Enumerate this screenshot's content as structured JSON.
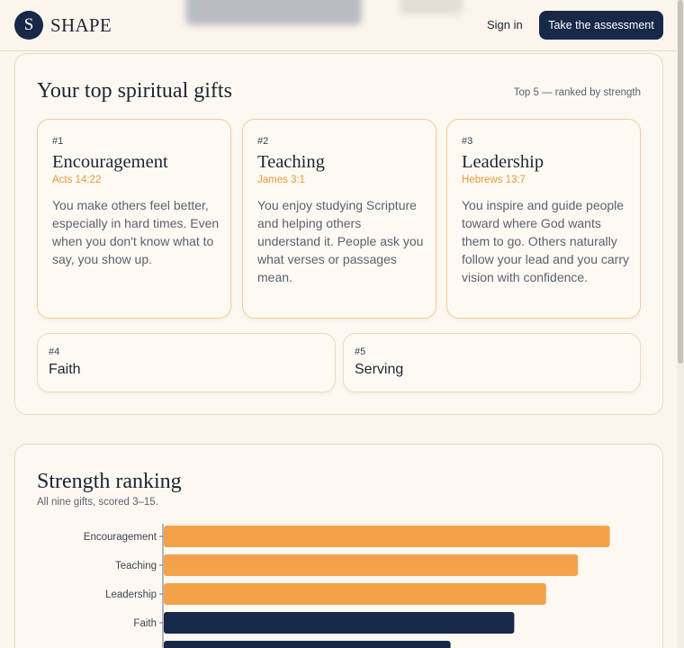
{
  "header": {
    "brand_initial": "S",
    "brand_name": "SHAPE",
    "sign_in_label": "Sign in",
    "cta_label": "Take the assessment"
  },
  "top_gifts": {
    "title": "Your top spiritual gifts",
    "subtitle": "Top 5 — ranked by strength",
    "featured": [
      {
        "rank": "#1",
        "name": "Encouragement",
        "verse": "Acts 14:22",
        "description": "You make others feel better, especially in hard times. Even when you don't know what to say, you show up."
      },
      {
        "rank": "#2",
        "name": "Teaching",
        "verse": "James 3:1",
        "description": "You enjoy studying Scripture and helping others understand it. People ask you what verses or passages mean."
      },
      {
        "rank": "#3",
        "name": "Leadership",
        "verse": "Hebrews 13:7",
        "description": "You inspire and guide people toward where God wants them to go. Others naturally follow your lead and you carry vision with confidence."
      }
    ],
    "others": [
      {
        "rank": "#4",
        "name": "Faith"
      },
      {
        "rank": "#5",
        "name": "Serving"
      }
    ]
  },
  "strength": {
    "title": "Strength ranking",
    "subtitle": "All nine gifts, scored 3–15."
  },
  "chart_data": {
    "type": "bar",
    "orientation": "horizontal",
    "categories": [
      "Encouragement",
      "Teaching",
      "Leadership",
      "Faith",
      ""
    ],
    "values": [
      14,
      13,
      12,
      11,
      9
    ],
    "xlim": [
      0,
      15
    ],
    "bar_colors": [
      "#f4a24a",
      "#f4a24a",
      "#f4a24a",
      "#172848",
      "#172848"
    ],
    "grid": false
  },
  "colors": {
    "navy": "#172848",
    "accent": "#f4a24a",
    "background": "#fbf5ec"
  }
}
